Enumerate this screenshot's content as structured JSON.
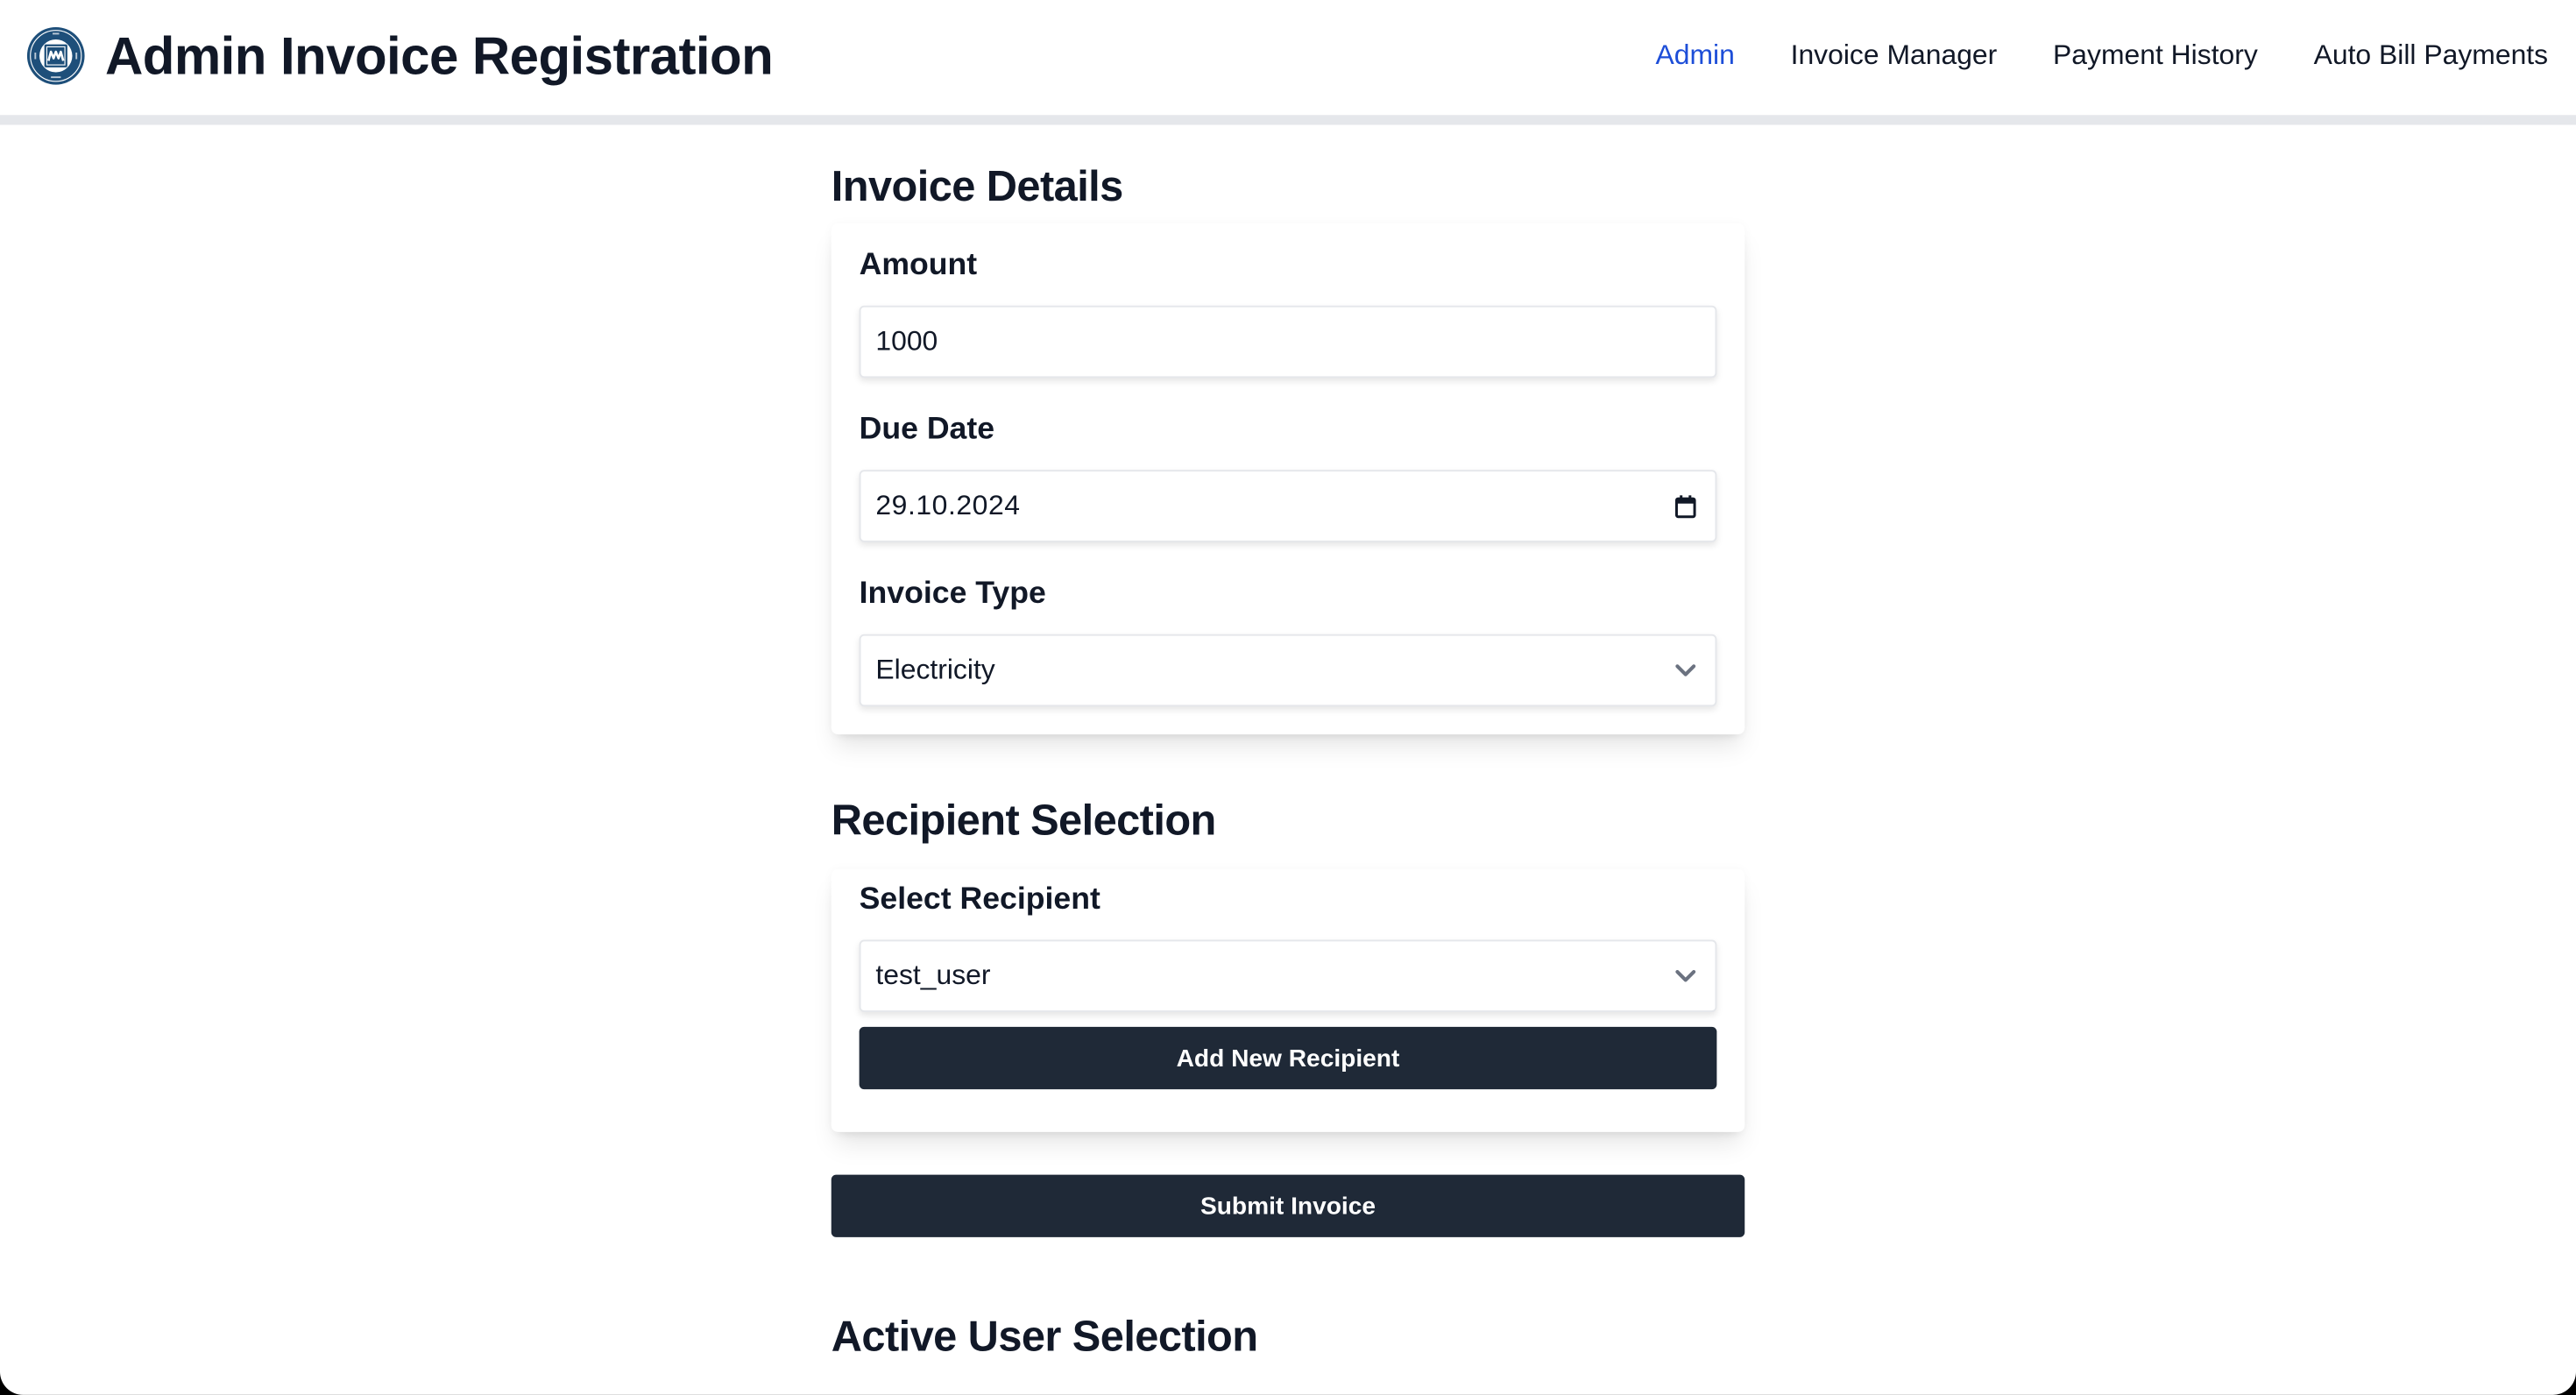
{
  "header": {
    "title": "Admin Invoice Registration",
    "logo": {
      "icon": "university-seal-logo",
      "ring_text": "MARMARA ÜNİVERSİTESİ",
      "year": "1883"
    },
    "nav": [
      {
        "label": "Admin",
        "active": true
      },
      {
        "label": "Invoice Manager",
        "active": false
      },
      {
        "label": "Payment History",
        "active": false
      },
      {
        "label": "Auto Bill Payments",
        "active": false
      }
    ]
  },
  "invoice_details": {
    "title": "Invoice Details",
    "amount": {
      "label": "Amount",
      "value": "1000"
    },
    "due_date": {
      "label": "Due Date",
      "value": "29.10.2024",
      "icon": "calendar-icon"
    },
    "invoice_type": {
      "label": "Invoice Type",
      "value": "Electricity",
      "icon": "chevron-down-icon"
    }
  },
  "recipient_selection": {
    "title": "Recipient Selection",
    "select_recipient": {
      "label": "Select Recipient",
      "value": "test_user",
      "icon": "chevron-down-icon"
    },
    "add_button": "Add New Recipient"
  },
  "submit_button": "Submit Invoice",
  "active_user_selection": {
    "title": "Active User Selection"
  },
  "colors": {
    "accent": "#1d4ed8",
    "button_bg": "#1f2937",
    "text": "#111827",
    "divider": "#e5e7eb",
    "chevron": "#6b7280"
  }
}
